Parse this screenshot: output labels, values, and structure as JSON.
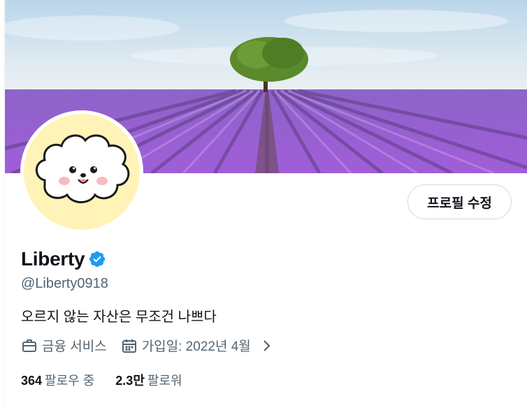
{
  "profile": {
    "display_name": "Liberty",
    "handle": "@Liberty0918",
    "bio": "오르지 않는 자산은 무조건 나쁘다",
    "category": "금융 서비스",
    "joined": "가입일: 2022년 4월",
    "verified": true
  },
  "actions": {
    "edit_profile_label": "프로필 수정"
  },
  "stats": {
    "following_count": "364",
    "following_label": "팔로우 중",
    "followers_count": "2.3만",
    "followers_label": "팔로워"
  },
  "icons": {
    "verified": "verified-badge-icon",
    "category": "briefcase-icon",
    "joined": "calendar-icon",
    "more": "chevron-right-icon"
  },
  "colors": {
    "verified_blue": "#1d9bf0",
    "secondary_text": "#536471",
    "primary_text": "#0f1419",
    "avatar_bg": "#fff3b8",
    "lavender": "#9a5fd1"
  }
}
